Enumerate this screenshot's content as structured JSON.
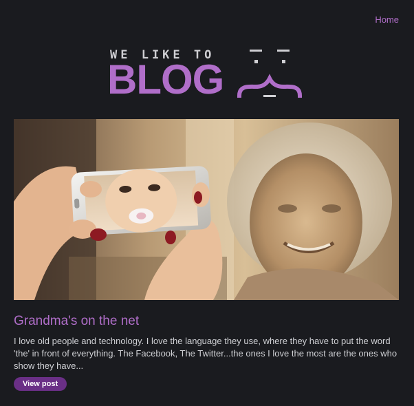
{
  "nav": {
    "home_label": "Home"
  },
  "logo": {
    "tagline": "WE LIKE TO",
    "wordmark": "BLOG"
  },
  "colors": {
    "accent": "#b06ec9",
    "button_bg": "#6a2f86",
    "background": "#1a1b1f"
  },
  "post": {
    "title": "Grandma's on the net",
    "excerpt": "I love old people and technology. I love the language they use, where they have to put the word 'the' in front of everything. The Facebook, The Twitter...the ones I love the most are the ones who show they have...",
    "button_label": "View post"
  }
}
